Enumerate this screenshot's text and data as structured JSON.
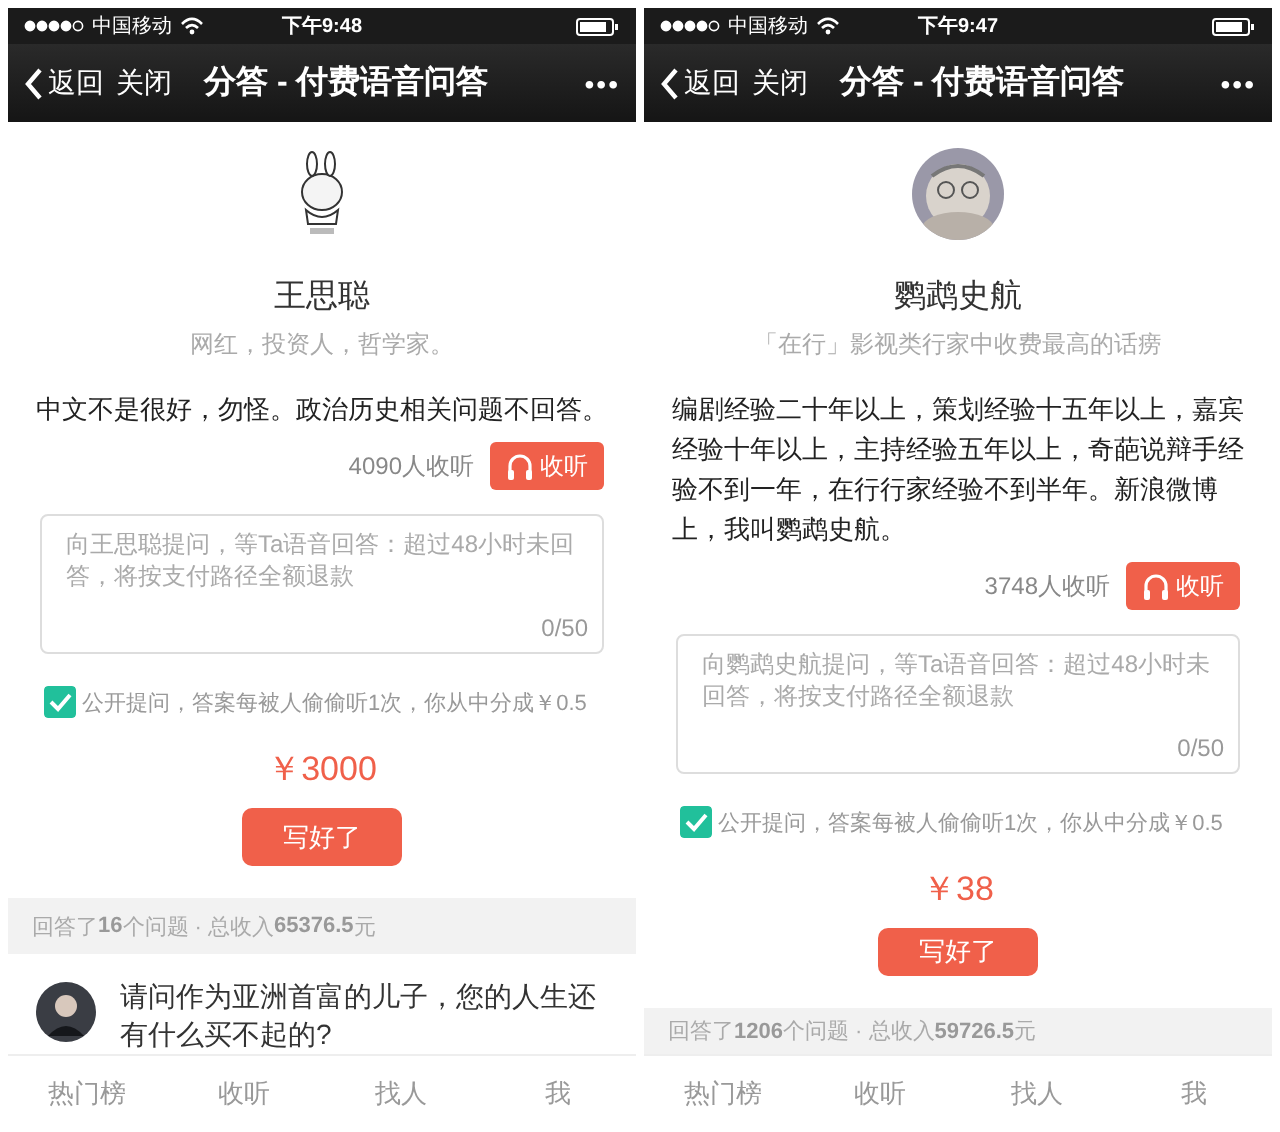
{
  "phones": [
    {
      "status_bar": {
        "carrier": "中国移动",
        "time": "下午9:48"
      },
      "nav": {
        "back": "返回",
        "close": "关闭",
        "title": "分答 - 付费语音问答",
        "more": "•••"
      },
      "profile": {
        "name": "王思聪",
        "tagline": "网红，投资人，哲学家。",
        "bio": "中文不是很好，勿怪。政治历史相关问题不回答。"
      },
      "listen": {
        "count": "4090人收听",
        "button": "收听"
      },
      "question_field": {
        "placeholder": "向王思聪提问，等Ta语音回答：超过48小时未回答，将按支付路径全额退款",
        "counter": "0/50"
      },
      "public_option": {
        "checked": true,
        "label": "公开提问，答案每被人偷偷听1次，你从中分成￥0.5"
      },
      "price": "￥3000",
      "submit_button": "写好了",
      "stats": "回答了**16**个问题 · 总收入**65376.5**元",
      "questions": [
        {
          "text": "请问作为亚洲首富的儿子，您的人生还有什么买不起的?"
        }
      ],
      "tabs": [
        {
          "label": "热门榜",
          "selected": false
        },
        {
          "label": "收听",
          "selected": false
        },
        {
          "label": "找人",
          "selected": false
        },
        {
          "label": "我",
          "selected": false
        }
      ]
    },
    {
      "status_bar": {
        "carrier": "中国移动",
        "time": "下午9:47"
      },
      "nav": {
        "back": "返回",
        "close": "关闭",
        "title": "分答 - 付费语音问答",
        "more": "•••"
      },
      "profile": {
        "name": "鹦鹉史航",
        "tagline": "「在行」影视类行家中收费最高的话痨",
        "bio": "编剧经验二十年以上，策划经验十五年以上，嘉宾经验十年以上，主持经验五年以上，奇葩说辩手经验不到一年，在行行家经验不到半年。新浪微博上，我叫鹦鹉史航。"
      },
      "listen": {
        "count": "3748人收听",
        "button": "收听"
      },
      "question_field": {
        "placeholder": "向鹦鹉史航提问，等Ta语音回答：超过48小时未回答，将按支付路径全额退款",
        "counter": "0/50"
      },
      "public_option": {
        "checked": true,
        "label": "公开提问，答案每被人偷偷听1次，你从中分成￥0.5"
      },
      "price": "￥38",
      "submit_button": "写好了",
      "stats": "回答了**1206**个问题 · 总收入**59726.5**元",
      "tabs": [
        {
          "label": "热门榜",
          "selected": false
        },
        {
          "label": "收听",
          "selected": false
        },
        {
          "label": "找人",
          "selected": false
        },
        {
          "label": "我",
          "selected": false
        }
      ]
    }
  ]
}
